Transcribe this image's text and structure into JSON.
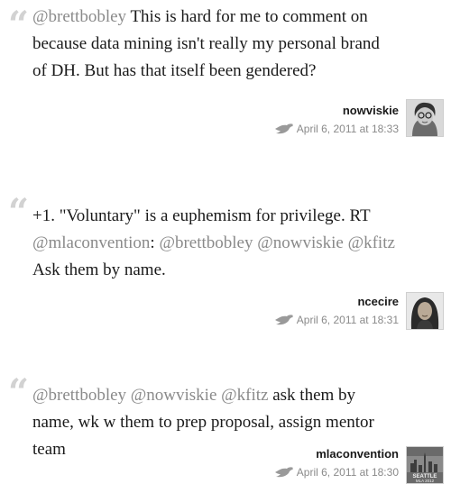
{
  "tweets": [
    {
      "lines": [
        [
          {
            "t": "@brettbobley",
            "m": true
          },
          {
            "t": " This is hard for me to comment on",
            "m": false
          }
        ],
        [
          {
            "t": "because data mining isn't really my personal brand",
            "m": false
          }
        ],
        [
          {
            "t": "of DH. But has that itself been gendered?",
            "m": false
          }
        ]
      ],
      "username": "nowviskie",
      "timestamp": "April 6, 2011 at 18:33",
      "avatar": "nowviskie-avatar"
    },
    {
      "lines": [
        [
          {
            "t": "+1. \"Voluntary\" is a euphemism for privilege. RT",
            "m": false
          }
        ],
        [
          {
            "t": "@mlaconvention",
            "m": true
          },
          {
            "t": ": ",
            "m": false
          },
          {
            "t": "@brettbobley",
            "m": true
          },
          {
            "t": " ",
            "m": false
          },
          {
            "t": "@nowviskie",
            "m": true
          },
          {
            "t": " ",
            "m": false
          },
          {
            "t": "@kfitz",
            "m": true
          }
        ],
        [
          {
            "t": "Ask them by name.",
            "m": false
          }
        ]
      ],
      "username": "ncecire",
      "timestamp": "April 6, 2011 at 18:31",
      "avatar": "ncecire-avatar"
    },
    {
      "lines": [
        [
          {
            "t": "@brettbobley",
            "m": true
          },
          {
            "t": " ",
            "m": false
          },
          {
            "t": "@nowviskie",
            "m": true
          },
          {
            "t": " ",
            "m": false
          },
          {
            "t": "@kfitz",
            "m": true
          },
          {
            "t": " ask them by",
            "m": false
          }
        ],
        [
          {
            "t": "name, wk w them to prep proposal, assign mentor",
            "m": false
          }
        ],
        [
          {
            "t": "team",
            "m": false
          }
        ]
      ],
      "username": "mlaconvention",
      "timestamp": "April 6, 2011 at 18:30",
      "avatar": "mlaconvention-avatar",
      "avatar_text": [
        "SEATTLE",
        "MLA 2012"
      ]
    }
  ],
  "quote_glyph": "“",
  "colors": {
    "mention": "#8a8a8a",
    "text": "#1a1a1a",
    "quote": "#d2d2d2"
  }
}
